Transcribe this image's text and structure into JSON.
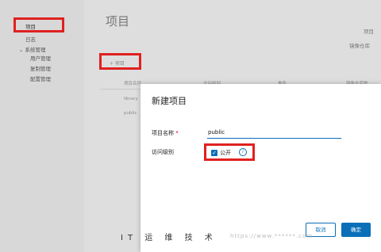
{
  "sidebar": {
    "items": [
      {
        "label": "项目"
      },
      {
        "label": "日志"
      },
      {
        "label": "系统管理"
      },
      {
        "label": "用户管理"
      },
      {
        "label": "复制管理"
      },
      {
        "label": "配置管理"
      }
    ]
  },
  "main": {
    "title": "项目",
    "top_right_1": "项目",
    "top_right_2": "镜像仓库",
    "new_button_label": "+ 项目",
    "table": {
      "headers": [
        "项目名称",
        "访问级别",
        "角色",
        "镜像仓库数"
      ],
      "rows": [
        {
          "name": "library"
        },
        {
          "name": "public"
        }
      ]
    }
  },
  "modal": {
    "title": "新建项目",
    "name_label": "项目名称",
    "name_required": "*",
    "name_value": "public",
    "visibility_label": "访问级别",
    "public_checked": true,
    "public_label": "公开",
    "cancel_label": "取消",
    "ok_label": "确定"
  },
  "watermark": {
    "text": "IT 运 维 技 术",
    "url": "https://www.******.com"
  },
  "colors": {
    "primary": "#0a6fb8",
    "highlight": "#e02020"
  }
}
